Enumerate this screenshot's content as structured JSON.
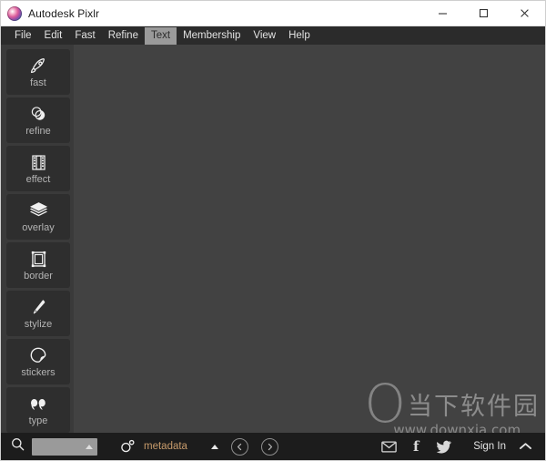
{
  "window": {
    "title": "Autodesk Pixlr",
    "app_icon": "pixlr-logo-icon",
    "controls": [
      {
        "name": "minimize-button",
        "icon": "minimize-icon",
        "label": "—"
      },
      {
        "name": "maximize-button",
        "icon": "maximize-icon",
        "label": "□"
      },
      {
        "name": "close-button",
        "icon": "close-icon",
        "label": "✕"
      }
    ]
  },
  "menubar": {
    "items": [
      {
        "label": "File",
        "active": false
      },
      {
        "label": "Edit",
        "active": false
      },
      {
        "label": "Fast",
        "active": false
      },
      {
        "label": "Refine",
        "active": false
      },
      {
        "label": "Text",
        "active": true
      },
      {
        "label": "Membership",
        "active": false
      },
      {
        "label": "View",
        "active": false
      },
      {
        "label": "Help",
        "active": false
      }
    ],
    "active_label": "Text"
  },
  "sidebar": {
    "items": [
      {
        "label": "fast",
        "icon": "rocket-icon"
      },
      {
        "label": "refine",
        "icon": "overlapping-circles-icon"
      },
      {
        "label": "effect",
        "icon": "film-strip-icon"
      },
      {
        "label": "overlay",
        "icon": "layers-icon"
      },
      {
        "label": "border",
        "icon": "frame-icon"
      },
      {
        "label": "stylize",
        "icon": "brush-pen-icon"
      },
      {
        "label": "stickers",
        "icon": "sticker-icon"
      },
      {
        "label": "type",
        "icon": "quote-marks-icon"
      }
    ]
  },
  "canvas": {
    "background_color": "#424242",
    "watermark": {
      "logo_letter": "O",
      "chinese_text": "当下软件园",
      "url": "www.downxia.com"
    }
  },
  "bottombar": {
    "search": {
      "icon": "search-icon",
      "value": "",
      "placeholder": "",
      "caret_icon": "caret-up-icon"
    },
    "metadata": {
      "icon": "aperture-bubble-icon",
      "label": "metadata",
      "label_color": "#c79b6b",
      "caret_icon": "caret-up-icon"
    },
    "nav": [
      {
        "name": "previous-button",
        "icon": "chevron-left-icon"
      },
      {
        "name": "next-button",
        "icon": "chevron-right-icon"
      }
    ],
    "social": [
      {
        "name": "email-share-button",
        "icon": "envelope-icon",
        "label": "✉"
      },
      {
        "name": "facebook-share-button",
        "icon": "facebook-icon",
        "label": "f"
      },
      {
        "name": "twitter-share-button",
        "icon": "twitter-bird-icon",
        "label": ""
      }
    ],
    "sign_in_label": "Sign In",
    "expand_icon": "chevron-up-icon"
  },
  "colors": {
    "titlebar_bg": "#ffffff",
    "menubar_bg": "#2b2b2b",
    "sidebar_bg": "#3a3a3a",
    "tool_bg": "#2e2e2e",
    "canvas_bg": "#424242",
    "bottombar_bg": "#1c1c1c",
    "accent_orange": "#c79b6b"
  }
}
